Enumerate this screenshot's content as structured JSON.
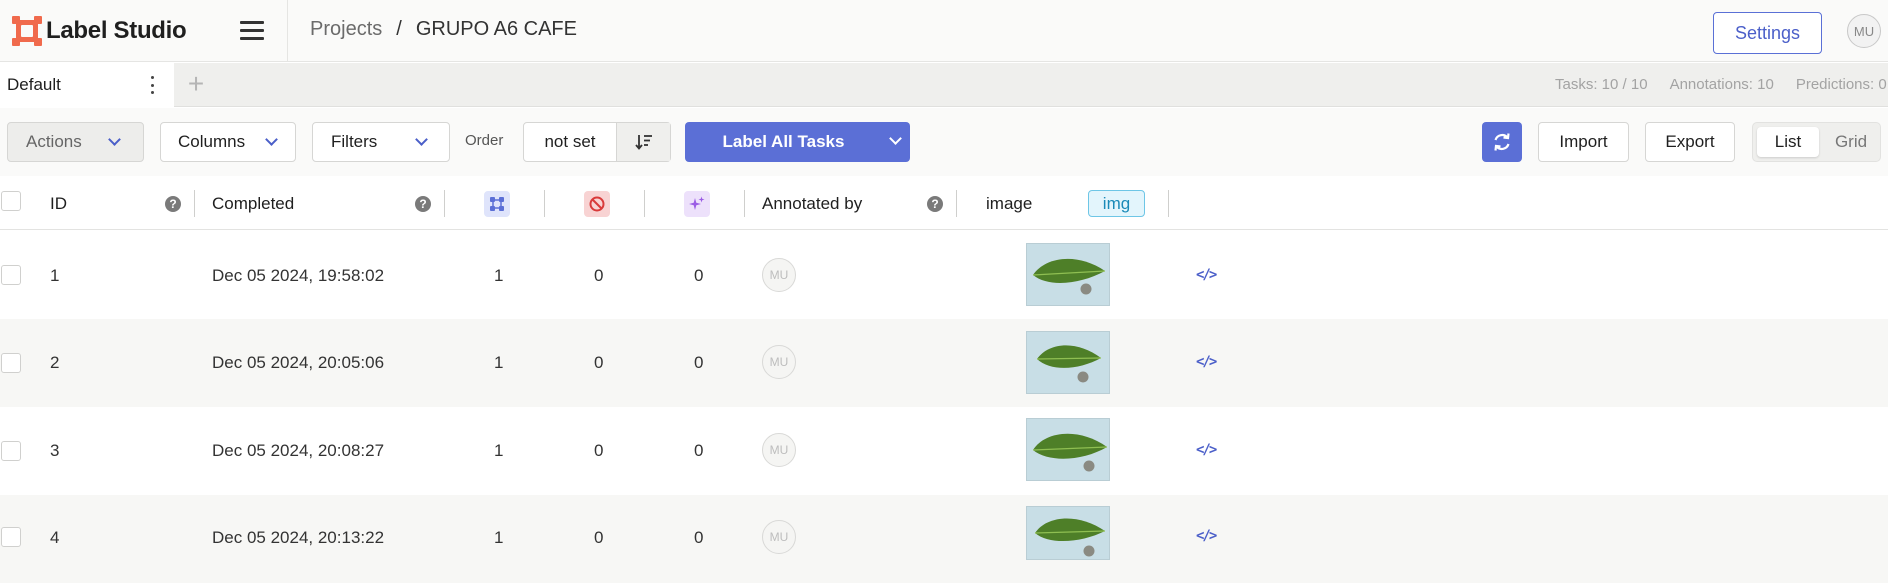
{
  "app": {
    "name": "Label Studio"
  },
  "breadcrumb": {
    "projects": "Projects",
    "separator": "/",
    "project": "GRUPO A6 CAFE"
  },
  "header": {
    "settings_label": "Settings",
    "avatar_initials": "MU"
  },
  "tabs": [
    {
      "label": "Default"
    }
  ],
  "stats": {
    "tasks": "Tasks: 10 / 10",
    "annotations": "Annotations: 10",
    "predictions": "Predictions: 0"
  },
  "toolbar": {
    "actions_label": "Actions",
    "columns_label": "Columns",
    "filters_label": "Filters",
    "order_label": "Order",
    "order_value": "not set",
    "label_all_label": "Label All Tasks",
    "import_label": "Import",
    "export_label": "Export",
    "view_list_label": "List",
    "view_grid_label": "Grid",
    "active_view": "List"
  },
  "table": {
    "columns": {
      "id": "ID",
      "completed": "Completed",
      "annotated_by": "Annotated by",
      "image": "image",
      "image_tag": "img"
    },
    "icons": {
      "total_annotations": "annotations-icon",
      "cancelled": "cancelled-icon",
      "predictions": "predictions-icon"
    },
    "rows": [
      {
        "id": "1",
        "completed": "Dec 05 2024, 19:58:02",
        "annotations": "1",
        "cancelled": "0",
        "predictions": "0",
        "annotator": "MU"
      },
      {
        "id": "2",
        "completed": "Dec 05 2024, 20:05:06",
        "annotations": "1",
        "cancelled": "0",
        "predictions": "0",
        "annotator": "MU"
      },
      {
        "id": "3",
        "completed": "Dec 05 2024, 20:08:27",
        "annotations": "1",
        "cancelled": "0",
        "predictions": "0",
        "annotator": "MU"
      },
      {
        "id": "4",
        "completed": "Dec 05 2024, 20:13:22",
        "annotations": "1",
        "cancelled": "0",
        "predictions": "0",
        "annotator": "MU"
      }
    ]
  },
  "colors": {
    "accent": "#5b6fd6",
    "logo": "#f06a4d",
    "img_badge": "#1a8ab8"
  }
}
